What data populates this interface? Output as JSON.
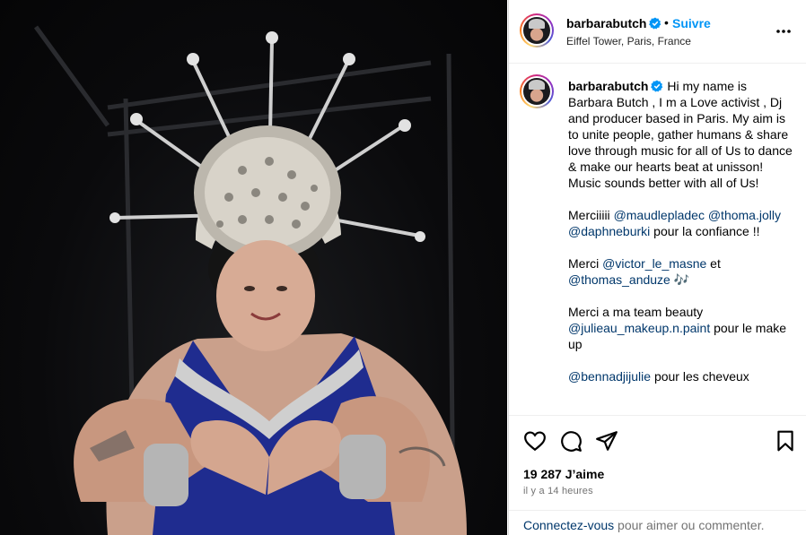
{
  "account": {
    "username": "barbarabutch",
    "follow_label": "Suivre",
    "dot": "•",
    "location": "Eiffel Tower, Paris, France"
  },
  "caption": {
    "username": "barbarabutch",
    "intro": "Hi my name is Barbara Butch , I m a Love activist , Dj and producer based in Paris. My aim is to unite people, gather humans & share love through music for all of Us to dance & make our hearts beat at unisson! Music sounds better with all of Us!",
    "merci1_prefix": "Merciiiii ",
    "mention1": "@maudlepladec",
    "mention2": "@thoma.jolly",
    "mention3": "@daphneburki",
    "merci1_suffix": " pour la confiance !!",
    "merci2_prefix": "Merci ",
    "mention4": "@victor_le_masne",
    "merci2_mid": " et",
    "mention5": "@thomas_anduze",
    "merci2_emoji": "🎶",
    "merci3_line": "Merci a ma team beauty",
    "mention6": "@julieau_makeup.n.paint",
    "merci3_suffix": " pour le make up",
    "mention7": "@bennadjijulie",
    "merci4_suffix": " pour les cheveux"
  },
  "stats": {
    "likes": "19 287 J’aime",
    "time": "il y a 14 heures"
  },
  "login": {
    "link": "Connectez-vous",
    "text": " pour aimer ou commenter."
  },
  "icons": {
    "verified": "verified-badge-icon",
    "more": "more-options-icon",
    "like": "heart-icon",
    "comment": "comment-icon",
    "share": "share-icon",
    "save": "bookmark-icon"
  },
  "colors": {
    "accent": "#0095f6",
    "mention": "#00376b",
    "secondary": "#737373",
    "dress": "#1f2c8f"
  }
}
